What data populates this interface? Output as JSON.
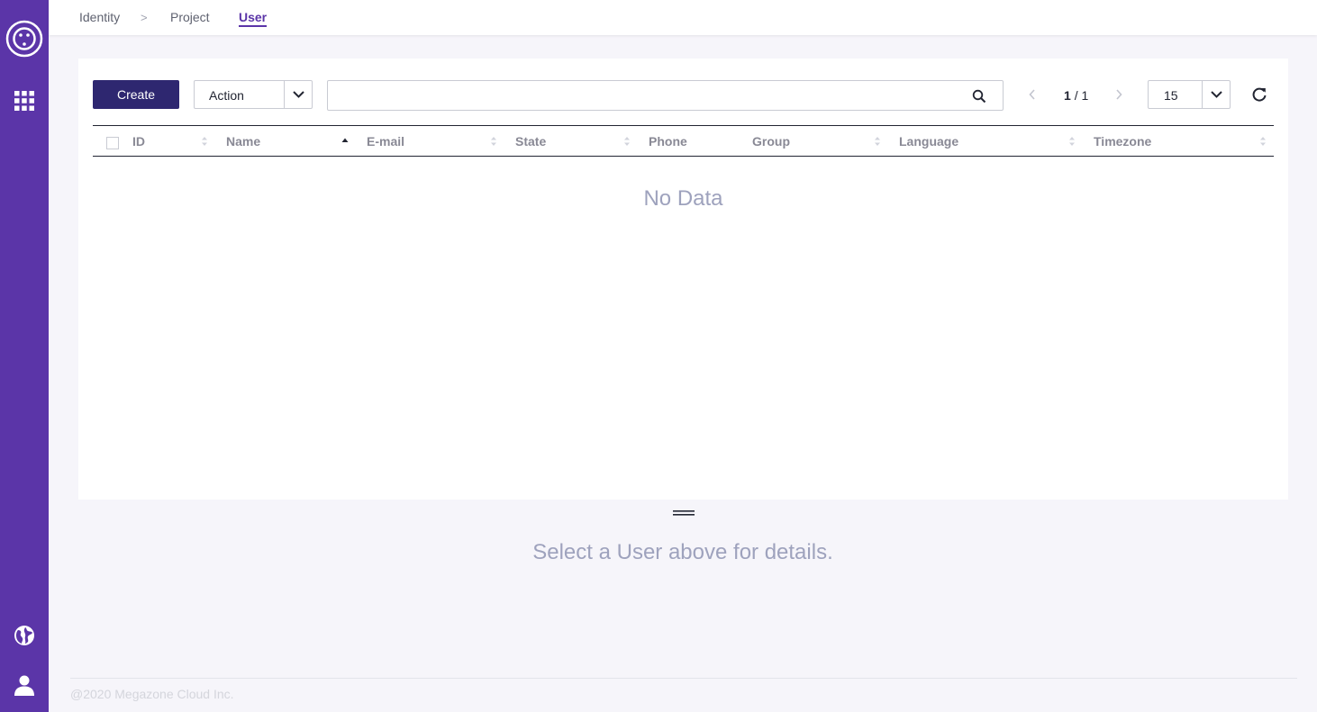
{
  "breadcrumb": {
    "items": [
      "Identity",
      "Project"
    ],
    "separator": ">",
    "current": "User"
  },
  "toolbar": {
    "create_label": "Create",
    "action_label": "Action",
    "search_value": "",
    "pagination": {
      "current": "1",
      "separator": "/",
      "total": "1"
    },
    "page_size": "15"
  },
  "table": {
    "columns": [
      "ID",
      "Name",
      "E-mail",
      "State",
      "Phone",
      "Group",
      "Language",
      "Timezone"
    ],
    "sorted_column": "Name",
    "sort_direction": "ascending",
    "rows": [],
    "empty_text": "No Data"
  },
  "details": {
    "empty_text": "Select a User above for details."
  },
  "footer": {
    "copyright": "@2020 Megazone Cloud Inc."
  },
  "colors": {
    "sidebar": "#5b35a8",
    "primary_button": "#2e2770",
    "accent": "#5b35a8",
    "muted_text": "#9ea2bd"
  },
  "icons": {
    "sidebar": [
      "logo-icon",
      "apps-grid-icon",
      "globe-icon",
      "user-profile-icon"
    ],
    "toolbar": [
      "chevron-down-icon",
      "search-icon",
      "chevron-left-icon",
      "chevron-right-icon",
      "refresh-icon"
    ]
  }
}
